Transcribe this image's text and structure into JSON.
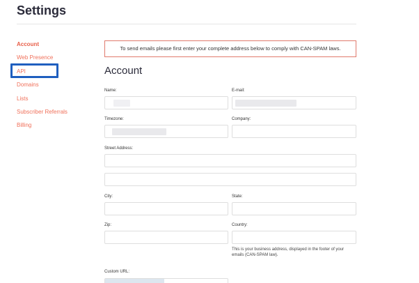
{
  "page": {
    "title": "Settings"
  },
  "sidebar": {
    "items": [
      {
        "label": "Account",
        "active": true
      },
      {
        "label": "Web Presence"
      },
      {
        "label": "API"
      },
      {
        "label": "Domains"
      },
      {
        "label": "Lists"
      },
      {
        "label": "Subscriber Referrals"
      },
      {
        "label": "Billing"
      }
    ]
  },
  "notice": {
    "text": "To send emails please first enter your complete address below to comply with CAN-SPAM laws."
  },
  "account": {
    "title": "Account",
    "fields": {
      "name": {
        "label": "Name:"
      },
      "email": {
        "label": "E-mail:"
      },
      "timezone": {
        "label": "Timezone:"
      },
      "company": {
        "label": "Company:"
      },
      "street": {
        "label": "Street Address:"
      },
      "city": {
        "label": "City:"
      },
      "state": {
        "label": "State:"
      },
      "zip": {
        "label": "Zip:"
      },
      "country": {
        "label": "Country:"
      },
      "custom_url": {
        "label": "Custom URL:"
      }
    },
    "country_help": "This is your business address, displayed in the footer of your emails (CAN-SPAM law)."
  },
  "colors": {
    "accent": "#f0705a",
    "highlight_border": "#1f5fbf",
    "notice_border": "#e07a6c"
  }
}
